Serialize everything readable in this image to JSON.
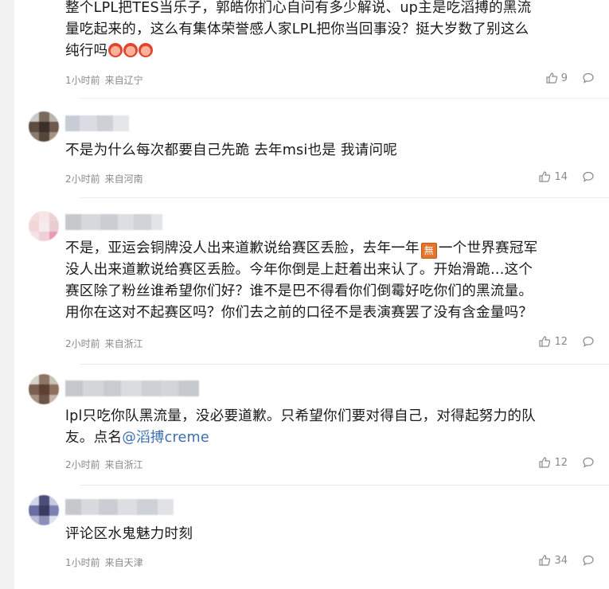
{
  "comments": [
    {
      "lines": [
        "整个LPL把TES当乐子，郭皓你扪心自问有多少解说、up主是吃滔搏的黑流",
        "量吃起来的，这么有集体荣誉感人家LPL把你当回事没？挺大岁数了别这么",
        "纯行吗"
      ],
      "time": "1小时前",
      "location": "来自辽宁",
      "likes": "9",
      "emoji_count": 3
    },
    {
      "lines": [
        "不是为什么每次都要自己先跪 去年msi也是 我请问呢"
      ],
      "time": "2小时前",
      "location": "来自河南",
      "likes": "14"
    },
    {
      "line1_a": "不是，亚运会铜牌没人出来道歉说给赛区丢脸，去年一年",
      "line1_badge": "無",
      "line1_b": "一个世界赛冠军",
      "lines": [
        "没人出来道歉说给赛区丢脸。今年你倒是上赶着出来认了。开始滑跪…这个",
        "赛区除了粉丝谁希望你们好？谁不是巴不得看你们倒霉好吃你们的黑流量。",
        "用你在这对不起赛区吗？你们去之前的口径不是表演赛罢了没有含金量吗？"
      ],
      "time": "2小时前",
      "location": "来自浙江",
      "likes": "12"
    },
    {
      "line1": "lpl只吃你队黑流量，没必要道歉。只希望你们要对得自己，对得起努力的队",
      "line2_a": "友。点名",
      "mention": "@滔搏creme",
      "time": "2小时前",
      "location": "来自浙江",
      "likes": "12"
    },
    {
      "lines": [
        "评论区水鬼魅力时刻"
      ],
      "time": "1小时前",
      "location": "来自天津",
      "likes": "34"
    }
  ]
}
